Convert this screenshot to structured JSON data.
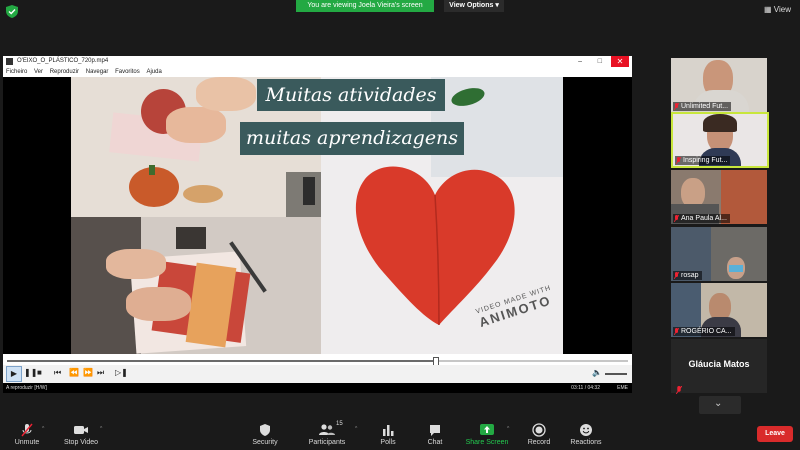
{
  "banner": {
    "viewing_text": "You are viewing Joela Vieira's screen",
    "view_options": "View Options",
    "view_label": "View"
  },
  "player": {
    "title": "O'EIXO_O_PLÁSTICO_720p.mp4",
    "menu": [
      "Ficheiro",
      "Ver",
      "Reproduzir",
      "Navegar",
      "Favoritos",
      "Ajuda"
    ],
    "progress": 0.69,
    "status_left": "A reproduzir [H/W]",
    "time": "03:11 / 04:32",
    "status_right": "EME"
  },
  "video": {
    "caption_1": "Muitas atividades",
    "caption_2": "muitas aprendizagens",
    "watermark_1": "VIDEO MADE WITH",
    "watermark_2": "ANIMOTO"
  },
  "participants": [
    {
      "name": "Unlimited Fut..."
    },
    {
      "name": "Inspiring Fut..."
    },
    {
      "name": "Ana Paula Al..."
    },
    {
      "name": "rosap"
    },
    {
      "name": "ROGÉRIO CA..."
    },
    {
      "name": "Gláucia Matos"
    }
  ],
  "toolbar": {
    "unmute": "Unmute",
    "stop_video": "Stop Video",
    "security": "Security",
    "participants": "Participants",
    "participant_count": "15",
    "polls": "Polls",
    "chat": "Chat",
    "share_screen": "Share Screen",
    "record": "Record",
    "reactions": "Reactions",
    "leave": "Leave"
  },
  "colors": {
    "share_green": "#23a943",
    "leave_red": "#d92b2b",
    "caption_bg": "#3a5a5c",
    "active_speaker": "#c8e63c"
  }
}
